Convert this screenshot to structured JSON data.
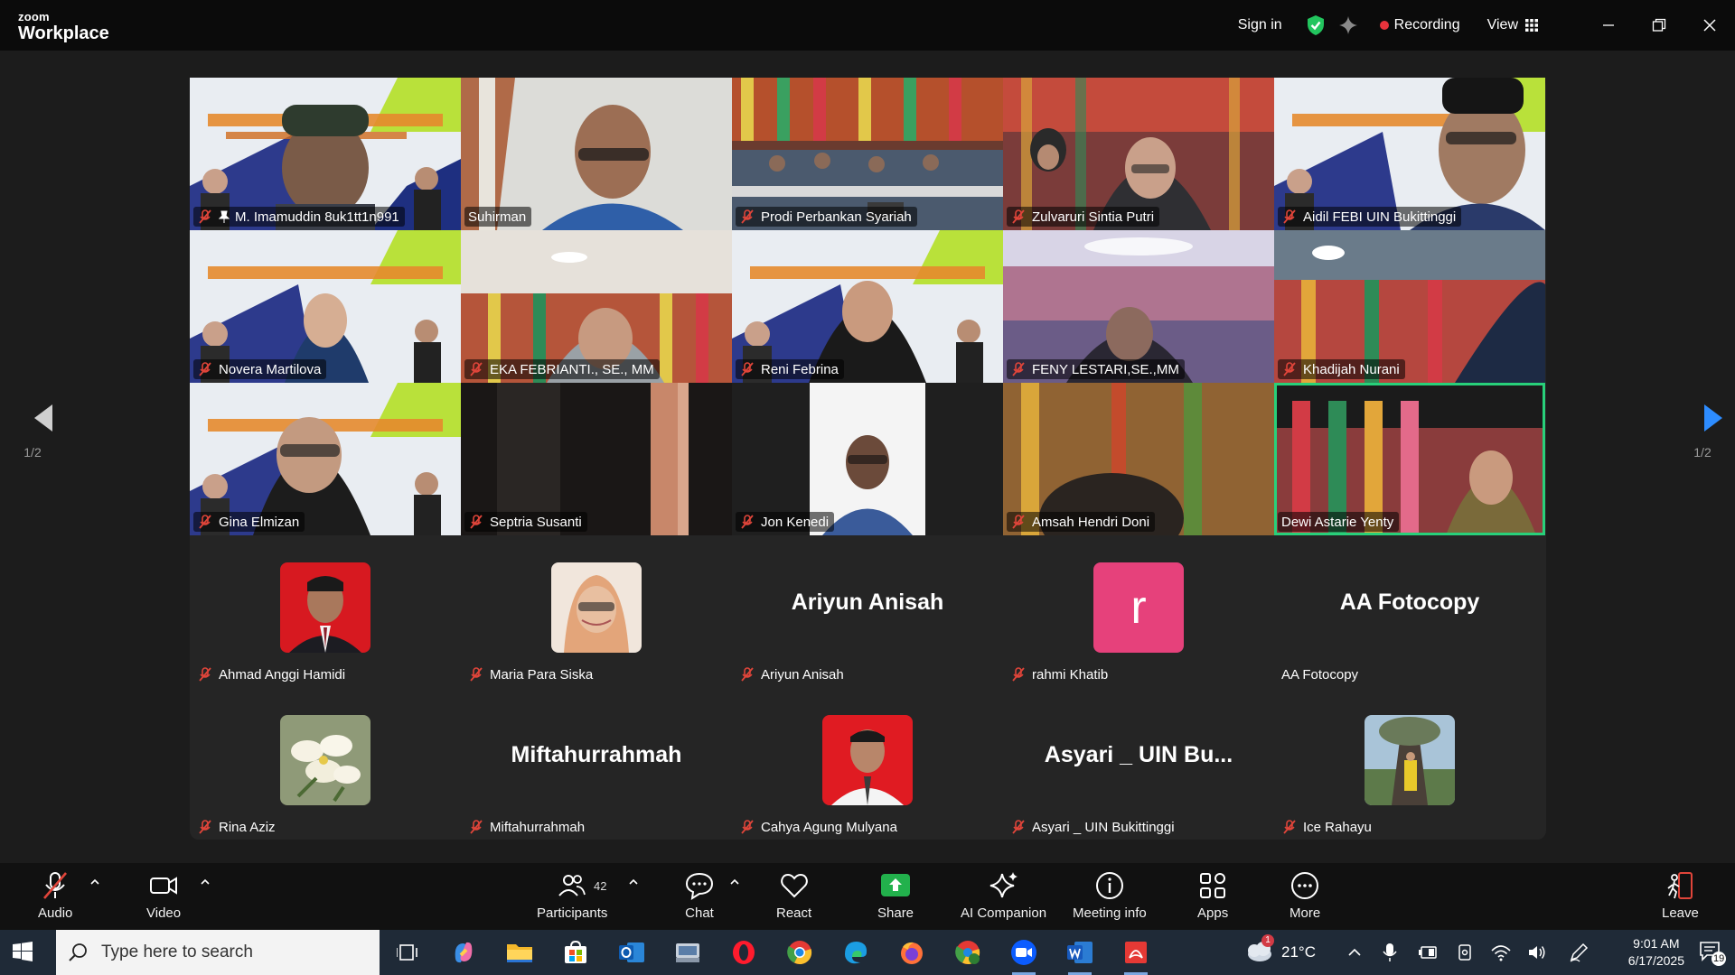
{
  "app": {
    "brand_top": "zoom",
    "brand_bottom": "Workplace"
  },
  "titlebar": {
    "signin": "Sign in",
    "recording": "Recording",
    "view": "View"
  },
  "pager": {
    "left": "1/2",
    "right": "1/2"
  },
  "video_tiles": [
    {
      "name": "M. Imamuddin 8uk1tt1n991",
      "pinned": true
    },
    {
      "name": "Suhirman",
      "muted": false
    },
    {
      "name": "Prodi Perbankan Syariah"
    },
    {
      "name": "Zulvaruri Sintia Putri"
    },
    {
      "name": "Aidil FEBI UIN Bukittinggi"
    },
    {
      "name": "Novera Martilova"
    },
    {
      "name": "EKA FEBRIANTI., SE., MM"
    },
    {
      "name": "Reni Febrina"
    },
    {
      "name": "FENY LESTARI,SE.,MM"
    },
    {
      "name": "Khadijah Nurani"
    },
    {
      "name": "Gina Elmizan"
    },
    {
      "name": "Septria Susanti"
    },
    {
      "name": "Jon Kenedi"
    },
    {
      "name": "Amsah Hendri Doni"
    },
    {
      "name": "Dewi Astarie Yenty",
      "active": true
    }
  ],
  "audio_tiles": [
    {
      "name": "Ahmad Anggi Hamidi",
      "display": ""
    },
    {
      "name": "Maria Para Siska",
      "display": ""
    },
    {
      "name": "Ariyun Anisah",
      "display": "Ariyun Anisah"
    },
    {
      "name": "rahmi Khatib",
      "display": "",
      "letter": "r"
    },
    {
      "name": "AA Fotocopy",
      "display": "AA Fotocopy",
      "muted": false
    },
    {
      "name": "Rina Aziz",
      "display": ""
    },
    {
      "name": "Miftahurrahmah",
      "display": "Miftahurrahmah"
    },
    {
      "name": "Cahya Agung Mulyana",
      "display": ""
    },
    {
      "name": "Asyari _ UIN Bukittinggi",
      "display": "Asyari _ UIN Bu..."
    },
    {
      "name": "Ice Rahayu",
      "display": ""
    }
  ],
  "toolbar": {
    "audio": "Audio",
    "video": "Video",
    "participants": "Participants",
    "participants_count": "42",
    "chat": "Chat",
    "react": "React",
    "share": "Share",
    "ai": "AI Companion",
    "info": "Meeting info",
    "apps": "Apps",
    "more": "More",
    "leave": "Leave"
  },
  "taskbar": {
    "search_placeholder": "Type here to search",
    "weather": "21°C",
    "time": "9:01 AM",
    "date": "6/17/2025",
    "notif_count": "19",
    "weather_badge": "1"
  },
  "colors": {
    "accent_green": "#28d07a",
    "recording_red": "#e8333c",
    "share_green": "#22b14c",
    "muted_red": "#e0453a"
  }
}
